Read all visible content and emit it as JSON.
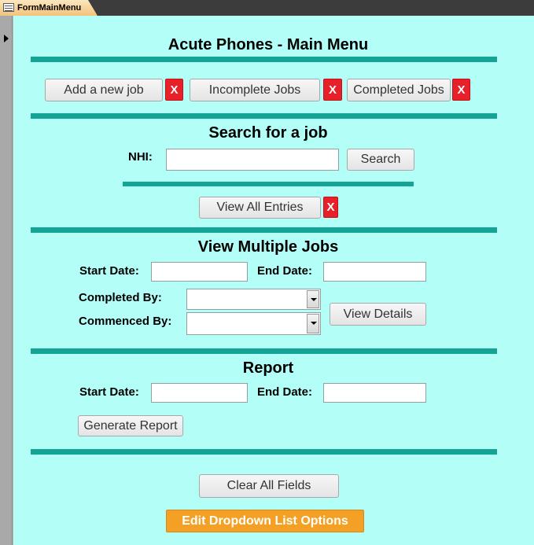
{
  "window": {
    "tab_title": "FormMainMenu"
  },
  "form": {
    "title": "Acute Phones - Main Menu",
    "jobs": {
      "add_new_job": "Add a new job",
      "incomplete_jobs": "Incomplete Jobs",
      "completed_jobs": "Completed Jobs",
      "close_label": "X"
    },
    "search": {
      "heading": "Search for a job",
      "nhi_label": "NHI:",
      "nhi_value": "",
      "search_button": "Search",
      "view_all_entries": "View All Entries",
      "close_label": "X"
    },
    "multiple": {
      "heading": "View Multiple Jobs",
      "start_date_label": "Start Date:",
      "end_date_label": "End Date:",
      "completed_by_label": "Completed By:",
      "commenced_by_label": "Commenced By:",
      "view_details": "View Details"
    },
    "report": {
      "heading": "Report",
      "start_date_label": "Start Date:",
      "end_date_label": "End Date:",
      "generate_report": "Generate Report"
    },
    "clear_all_fields": "Clear All Fields",
    "edit_dropdown": "Edit Dropdown List Options"
  },
  "colors": {
    "form_background": "#b3fff7",
    "rule": "#14a394",
    "close_button": "#e8202a",
    "accent_button": "#f3a024"
  }
}
